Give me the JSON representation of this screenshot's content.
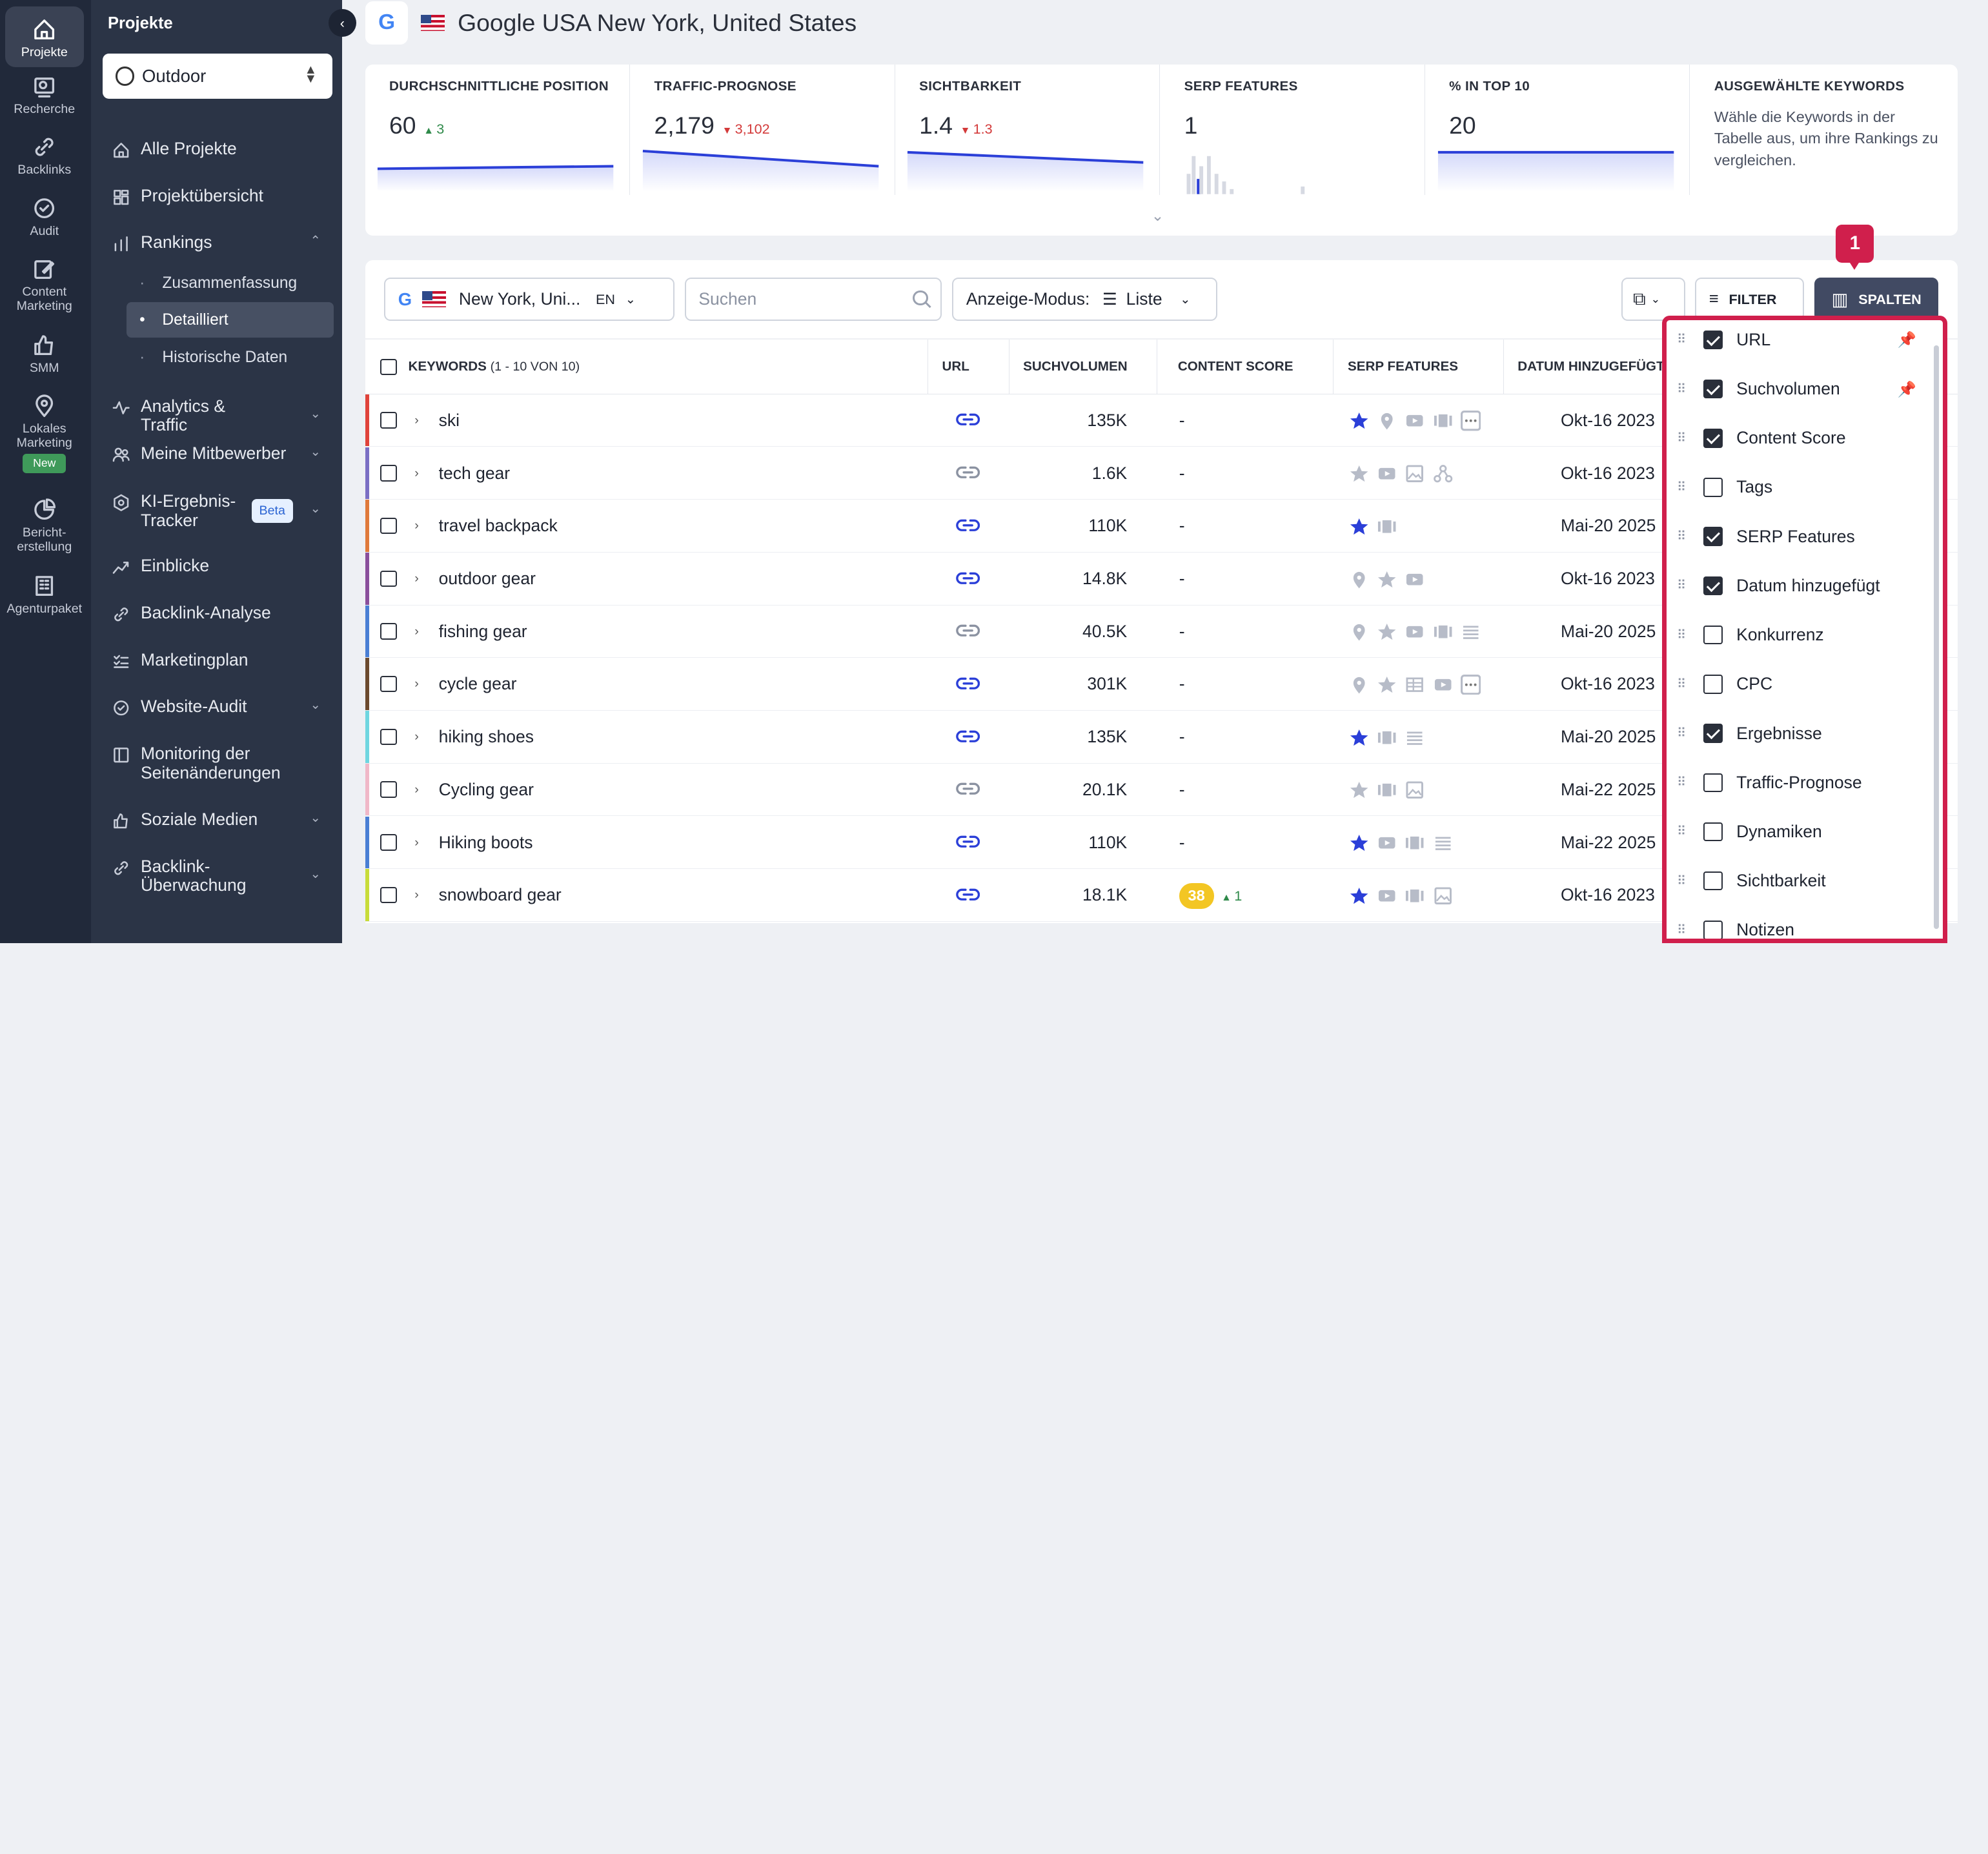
{
  "rail": [
    {
      "label": "Projekte",
      "icon": "home-icon",
      "active": true
    },
    {
      "label": "Recherche",
      "icon": "research-icon"
    },
    {
      "label": "Backlinks",
      "icon": "link-icon"
    },
    {
      "label": "Audit",
      "icon": "audit-icon"
    },
    {
      "label": "Content Marketing",
      "icon": "edit-icon"
    },
    {
      "label": "SMM",
      "icon": "thumbs-up-icon"
    },
    {
      "label": "Lokales Marketing",
      "icon": "location-pin-icon",
      "badge": "New"
    },
    {
      "label": "Bericht-erstellung",
      "icon": "report-icon"
    },
    {
      "label": "Agenturpaket",
      "icon": "building-icon"
    }
  ],
  "sidebar": {
    "title": "Projekte",
    "project": "Outdoor",
    "items": [
      {
        "label": "Alle Projekte",
        "icon": "home-icon"
      },
      {
        "label": "Projektübersicht",
        "icon": "dashboard-icon"
      },
      {
        "label": "Rankings",
        "icon": "bar-chart-icon",
        "expanded": true
      },
      {
        "label": "Analytics & Traffic",
        "icon": "analytics-icon"
      },
      {
        "label": "Meine Mitbewerber",
        "icon": "users-icon"
      },
      {
        "label": "KI-Ergebnis-Tracker",
        "icon": "ai-icon",
        "badge": "Beta"
      },
      {
        "label": "Einblicke",
        "icon": "insights-icon"
      },
      {
        "label": "Backlink-Analyse",
        "icon": "link-icon"
      },
      {
        "label": "Marketingplan",
        "icon": "checklist-icon"
      },
      {
        "label": "Website-Audit",
        "icon": "audit-icon"
      },
      {
        "label": "Monitoring der Seitenänderungen",
        "icon": "page-monitor-icon"
      },
      {
        "label": "Soziale Medien",
        "icon": "thumbs-up-icon"
      },
      {
        "label": "Backlink-Überwachung",
        "icon": "link-icon"
      }
    ],
    "subitems": [
      "Zusammenfassung",
      "Detailliert",
      "Historische Daten"
    ]
  },
  "header": {
    "engine": "G",
    "title": "Google USA New York, United States"
  },
  "metrics": [
    {
      "title": "DURCHSCHNITTLICHE POSITION",
      "value": "60",
      "delta": "3",
      "trend": "up"
    },
    {
      "title": "TRAFFIC-PROGNOSE",
      "value": "2,179",
      "delta": "3,102",
      "trend": "down"
    },
    {
      "title": "SICHTBARKEIT",
      "value": "1.4",
      "delta": "1.3",
      "trend": "down"
    },
    {
      "title": "SERP FEATURES",
      "value": "1"
    },
    {
      "title": "% IN TOP 10",
      "value": "20"
    },
    {
      "title": "AUSGEWÄHLTE KEYWORDS",
      "description": "Wähle die Keywords in der Tabelle aus, um ihre Rankings zu vergleichen."
    }
  ],
  "toolbar": {
    "location": "New York, Uni...",
    "lang": "EN",
    "search_placeholder": "Suchen",
    "mode_label": "Anzeige-Modus:",
    "mode_value": "Liste",
    "filter_label": "FILTER",
    "columns_label": "SPALTEN",
    "step_badge": "1"
  },
  "table": {
    "headers": {
      "keywords": "KEYWORDS",
      "keywords_count": "(1 - 10 VON 10)",
      "url": "URL",
      "volume": "SUCHVOLUMEN",
      "content_score": "CONTENT SCORE",
      "serp": "SERP FEATURES",
      "date": "DATUM HINZUGEFÜGT"
    },
    "rows": [
      {
        "keyword": "ski",
        "volume": "135K",
        "content_score": "-",
        "date": "Okt-16 2023",
        "stripe": "#e0433b",
        "url_active": true,
        "serp": [
          "star-icon",
          "location-pin-icon",
          "video-icon",
          "carousel-icon",
          "more-icon"
        ],
        "star_active": true
      },
      {
        "keyword": "tech gear",
        "volume": "1.6K",
        "content_score": "-",
        "date": "Okt-16 2023",
        "stripe": "#7b6fc4",
        "url_active": false,
        "serp": [
          "star-icon",
          "video-icon",
          "image-icon",
          "network-icon"
        ],
        "star_active": false
      },
      {
        "keyword": "travel backpack",
        "volume": "110K",
        "content_score": "-",
        "date": "Mai-20 2025",
        "stripe": "#e07a3b",
        "url_active": true,
        "serp": [
          "star-icon",
          "carousel-icon"
        ],
        "star_active": true
      },
      {
        "keyword": "outdoor gear",
        "volume": "14.8K",
        "content_score": "-",
        "date": "Okt-16 2023",
        "stripe": "#8a4f9c",
        "url_active": true,
        "serp": [
          "location-pin-icon",
          "star-icon",
          "video-icon"
        ],
        "star_active": false
      },
      {
        "keyword": "fishing gear",
        "volume": "40.5K",
        "content_score": "-",
        "date": "Mai-20 2025",
        "stripe": "#4a7fd4",
        "url_active": false,
        "serp": [
          "location-pin-icon",
          "star-icon",
          "video-icon",
          "carousel-icon",
          "list-icon"
        ],
        "star_active": false
      },
      {
        "keyword": "cycle gear",
        "volume": "301K",
        "content_score": "-",
        "date": "Okt-16 2023",
        "stripe": "#6b4a2e",
        "url_active": true,
        "serp": [
          "location-pin-icon",
          "star-icon",
          "table-icon",
          "video-icon",
          "more-icon"
        ],
        "star_active": false
      },
      {
        "keyword": "hiking shoes",
        "volume": "135K",
        "content_score": "-",
        "date": "Mai-20 2025",
        "stripe": "#6fd6e0",
        "url_active": true,
        "serp": [
          "star-icon",
          "carousel-icon",
          "list-icon"
        ],
        "star_active": true
      },
      {
        "keyword": "Cycling gear",
        "volume": "20.1K",
        "content_score": "-",
        "date": "Mai-22 2025",
        "stripe": "#f0b8c8",
        "url_active": false,
        "serp": [
          "star-icon",
          "carousel-icon",
          "image-icon"
        ],
        "star_active": false
      },
      {
        "keyword": "Hiking boots",
        "volume": "110K",
        "content_score": "-",
        "date": "Mai-22 2025",
        "stripe": "#4a7fd4",
        "url_active": true,
        "serp": [
          "star-icon",
          "video-icon",
          "carousel-icon",
          "list-icon"
        ],
        "star_active": true
      },
      {
        "keyword": "snowboard gear",
        "volume": "18.1K",
        "content_score": "38",
        "content_delta": "1",
        "date": "Okt-16 2023",
        "stripe": "#c8dc3a",
        "url_active": true,
        "serp": [
          "star-icon",
          "video-icon",
          "carousel-icon",
          "image-icon"
        ],
        "star_active": true
      }
    ]
  },
  "columns_panel": [
    {
      "label": "URL",
      "checked": true,
      "pinned": true
    },
    {
      "label": "Suchvolumen",
      "checked": true,
      "pinned": true
    },
    {
      "label": "Content Score",
      "checked": true
    },
    {
      "label": "Tags",
      "checked": false
    },
    {
      "label": "SERP Features",
      "checked": true
    },
    {
      "label": "Datum hinzugefügt",
      "checked": true
    },
    {
      "label": "Konkurrenz",
      "checked": false
    },
    {
      "label": "CPC",
      "checked": false
    },
    {
      "label": "Ergebnisse",
      "checked": true
    },
    {
      "label": "Traffic-Prognose",
      "checked": false
    },
    {
      "label": "Dynamiken",
      "checked": false
    },
    {
      "label": "Sichtbarkeit",
      "checked": false
    },
    {
      "label": "Notizen",
      "checked": false
    }
  ],
  "colors": {
    "accent": "#2b50e0",
    "dark": "#21293a",
    "highlight": "#d01f4c",
    "up": "#2f8a4a",
    "down": "#d33a3a"
  }
}
